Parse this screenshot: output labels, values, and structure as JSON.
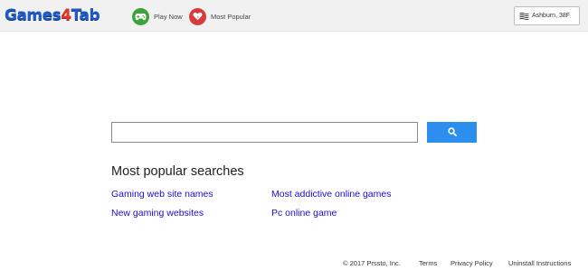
{
  "header": {
    "logo_text_a": "Games",
    "logo_text_b": "4",
    "logo_text_c": "Tab",
    "nav": [
      {
        "label": "Play Now",
        "icon": "gamepad-icon"
      },
      {
        "label": "Most Popular",
        "icon": "heart-icon"
      }
    ],
    "weather": {
      "label": "Ashburn, 38F",
      "icon": "weather-icon"
    }
  },
  "search": {
    "value": "",
    "placeholder": "",
    "button_icon": "search-icon"
  },
  "popular": {
    "title": "Most popular searches",
    "links": [
      "Gaming web site names",
      "Most addictive online games",
      "New gaming websites",
      "Pc online game"
    ]
  },
  "footer": {
    "copyright": "© 2017 Prssto, Inc.",
    "links": [
      "Terms",
      "Privacy Policy",
      "Uninstall Instructions"
    ]
  },
  "colors": {
    "logo_blue": "#1e5bc6",
    "logo_red": "#e6352b",
    "play_green": "#3aa339",
    "popular_red": "#d93a3a",
    "search_button_blue": "#2c8ff0",
    "link_blue": "#1a0dcc"
  }
}
